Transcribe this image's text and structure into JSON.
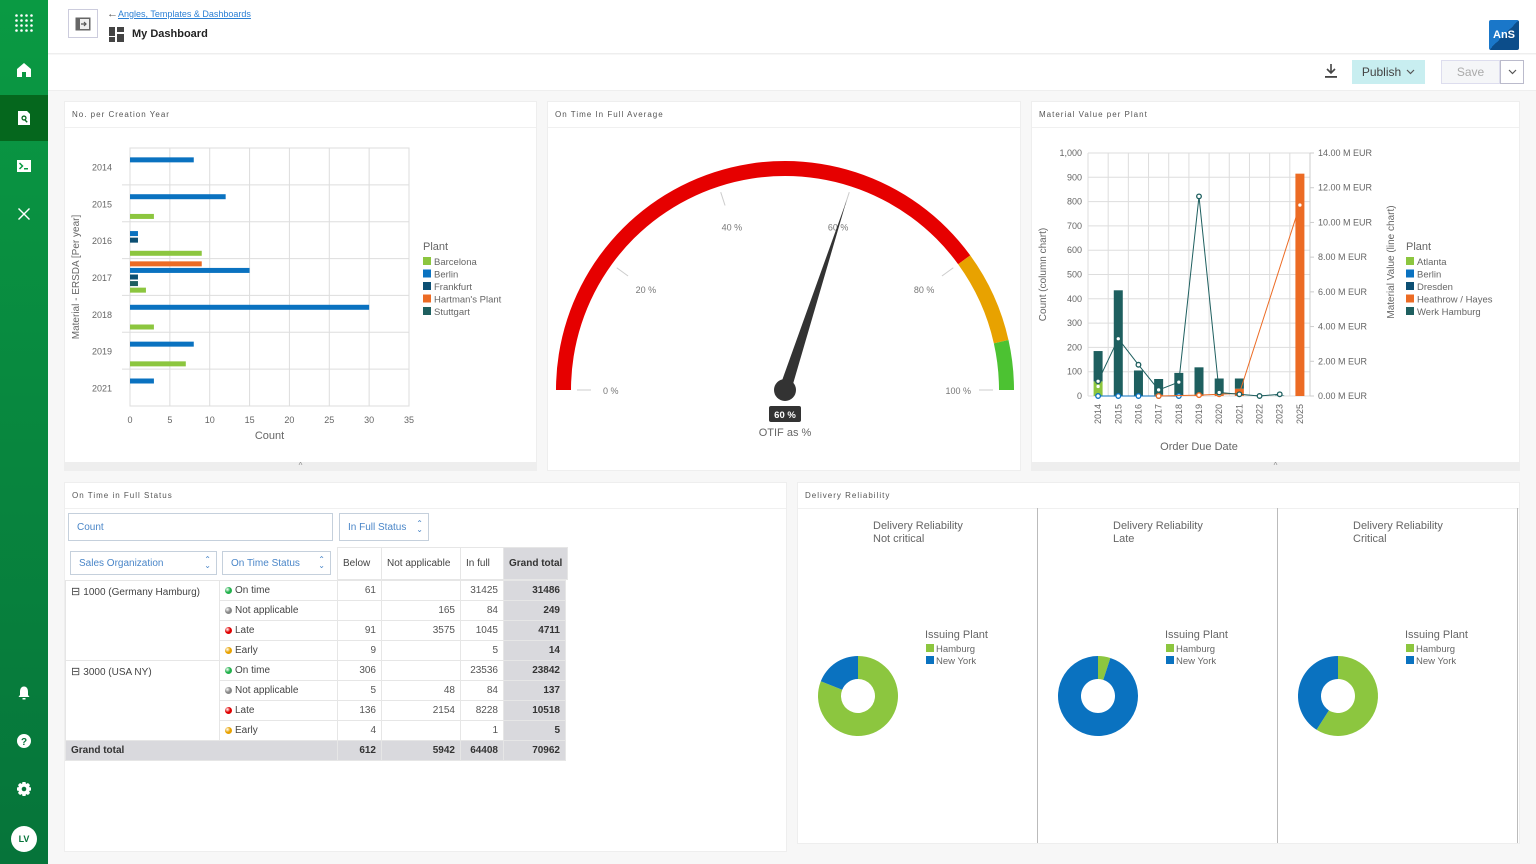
{
  "sidebar": {
    "items": [
      {
        "name": "apps-grid",
        "label": "Apps"
      },
      {
        "name": "home",
        "label": "Home"
      },
      {
        "name": "search-document",
        "label": "Search",
        "active": true
      },
      {
        "name": "terminal",
        "label": "Console"
      },
      {
        "name": "tools",
        "label": "Tools"
      }
    ],
    "bottom": [
      {
        "name": "bell",
        "label": "Notifications"
      },
      {
        "name": "help",
        "label": "Help"
      },
      {
        "name": "gear",
        "label": "Settings"
      }
    ],
    "avatar_initials": "LV"
  },
  "header": {
    "back_link": "Angles, Templates & Dashboards",
    "title": "My Dashboard",
    "logo_text": "AnS"
  },
  "toolbar": {
    "publish_label": "Publish",
    "save_label": "Save"
  },
  "panels": {
    "p1_title": "No. per Creation Year",
    "p2_title": "On Time In Full Average",
    "p3_title": "Material Value per Plant",
    "p4_title": "On Time in Full Status",
    "p5_title": "Delivery Reliability"
  },
  "chart_data": [
    {
      "type": "bar",
      "orientation": "horizontal",
      "title": "No. per Creation Year",
      "xlabel": "Count",
      "ylabel": "Material - ERSDA [Per year]",
      "xlim": [
        0,
        35
      ],
      "xticks": [
        0,
        5,
        10,
        15,
        20,
        25,
        30,
        35
      ],
      "categories": [
        "2014",
        "2015",
        "2016",
        "2017",
        "2018",
        "2019",
        "2021"
      ],
      "legend_title": "Plant",
      "legend_position": "right",
      "series": [
        {
          "name": "Barcelona",
          "color": "#8cc63f",
          "values": [
            0,
            3,
            9,
            2,
            3,
            7,
            0
          ]
        },
        {
          "name": "Berlin",
          "color": "#0a72c0",
          "values": [
            8,
            12,
            1,
            15,
            30,
            8,
            3
          ]
        },
        {
          "name": "Frankfurt",
          "color": "#0c4f73",
          "values": [
            0,
            0,
            1,
            1,
            0,
            0,
            0
          ]
        },
        {
          "name": "Hartman's Plant",
          "color": "#ec6b24",
          "values": [
            0,
            0,
            0,
            9,
            0,
            0,
            0
          ]
        },
        {
          "name": "Stuttgart",
          "color": "#1e5f5f",
          "values": [
            0,
            0,
            0,
            1,
            0,
            0,
            0
          ]
        }
      ]
    },
    {
      "type": "gauge",
      "title": "On Time In Full Average",
      "value": 60,
      "value_label": "60 %",
      "caption": "OTIF as %",
      "min": 0,
      "max": 100,
      "ticks": [
        "0 %",
        "20 %",
        "40 %",
        "60 %",
        "80 %",
        "100 %"
      ],
      "bands": [
        {
          "from": 0,
          "to": 80,
          "color": "#e60000"
        },
        {
          "from": 80,
          "to": 93,
          "color": "#e8a200"
        },
        {
          "from": 93,
          "to": 100,
          "color": "#4cc232"
        }
      ]
    },
    {
      "type": "bar+line",
      "title": "Material Value per Plant",
      "xlabel": "Order Due Date",
      "ylabel": "Count (column chart)",
      "y2label": "Material Value (line chart)",
      "ylim": [
        0,
        1000
      ],
      "yticks": [
        "0",
        "100",
        "200",
        "300",
        "400",
        "500",
        "600",
        "700",
        "800",
        "900",
        "1,000"
      ],
      "y2lim": [
        0,
        14
      ],
      "y2ticks": [
        "0.00 M EUR",
        "2.00 M EUR",
        "4.00 M EUR",
        "6.00 M EUR",
        "8.00 M EUR",
        "10.00 M EUR",
        "12.00 M EUR",
        "14.00 M EUR"
      ],
      "categories": [
        "2014",
        "2015",
        "2016",
        "2017",
        "2018",
        "2019",
        "2020",
        "2021",
        "2022",
        "2023",
        "2025"
      ],
      "legend_title": "Plant",
      "legend_position": "right",
      "bar_series": [
        {
          "name": "Atlanta",
          "color": "#8cc63f",
          "values": [
            60,
            0,
            0,
            0,
            0,
            0,
            0,
            0,
            0,
            0,
            0
          ]
        },
        {
          "name": "Heathrow / Hayes",
          "color": "#ec6b24",
          "values": [
            0,
            0,
            0,
            5,
            0,
            5,
            5,
            30,
            0,
            0,
            915
          ]
        },
        {
          "name": "Werk Hamburg",
          "color": "#1e5f5f",
          "values": [
            125,
            435,
            105,
            65,
            95,
            113,
            67,
            42,
            3,
            2,
            0
          ]
        }
      ],
      "line_series": [
        {
          "name": "Berlin",
          "color": "#0a72c0",
          "values": [
            0,
            0,
            0,
            0,
            0,
            null,
            null,
            null,
            null,
            null,
            null
          ]
        },
        {
          "name": "Atlanta",
          "color": "#8cc63f",
          "values": [
            0.55,
            null,
            null,
            null,
            null,
            null,
            null,
            null,
            null,
            null,
            null
          ]
        },
        {
          "name": "Heathrow / Hayes",
          "color": "#ec6b24",
          "values": [
            null,
            null,
            null,
            0,
            null,
            0.05,
            0.1,
            0.15,
            null,
            null,
            11.0
          ]
        },
        {
          "name": "Werk Hamburg",
          "color": "#1e5f5f",
          "values": [
            0.85,
            3.3,
            1.8,
            0.35,
            0.8,
            11.5,
            0.2,
            0.1,
            0,
            0.1,
            null
          ]
        }
      ],
      "legend": [
        {
          "name": "Atlanta",
          "color": "#8cc63f"
        },
        {
          "name": "Berlin",
          "color": "#0a72c0"
        },
        {
          "name": "Dresden",
          "color": "#0c4f73"
        },
        {
          "name": "Heathrow / Hayes",
          "color": "#ec6b24"
        },
        {
          "name": "Werk Hamburg",
          "color": "#1e5f5f"
        }
      ]
    },
    {
      "type": "table",
      "title": "On Time in Full Status",
      "value_field": "Count",
      "column_field": "In Full Status",
      "row_fields": [
        "Sales Organization",
        "On Time Status"
      ],
      "columns": [
        "Below",
        "Not applicable",
        "In full",
        "Grand total"
      ],
      "groups": [
        {
          "label": "1000 (Germany Hamburg)",
          "rows": [
            {
              "status": "On time",
              "color": "#22b14c",
              "values": [
                "61",
                "",
                "31425",
                "31486"
              ]
            },
            {
              "status": "Not applicable",
              "color": "#888888",
              "values": [
                "",
                "165",
                "84",
                "249"
              ]
            },
            {
              "status": "Late",
              "color": "#e00000",
              "values": [
                "91",
                "3575",
                "1045",
                "4711"
              ]
            },
            {
              "status": "Early",
              "color": "#e8a200",
              "values": [
                "9",
                "",
                "5",
                "14"
              ]
            }
          ]
        },
        {
          "label": "3000 (USA NY)",
          "rows": [
            {
              "status": "On time",
              "color": "#22b14c",
              "values": [
                "306",
                "",
                "23536",
                "23842"
              ]
            },
            {
              "status": "Not applicable",
              "color": "#888888",
              "values": [
                "5",
                "48",
                "84",
                "137"
              ]
            },
            {
              "status": "Late",
              "color": "#e00000",
              "values": [
                "136",
                "2154",
                "8228",
                "10518"
              ]
            },
            {
              "status": "Early",
              "color": "#e8a200",
              "values": [
                "4",
                "",
                "1",
                "5"
              ]
            }
          ]
        }
      ],
      "grand_total_label": "Grand total",
      "grand_total": [
        "612",
        "5942",
        "64408",
        "70962"
      ]
    },
    {
      "type": "pie",
      "title": "Delivery Reliability",
      "subtitle": "Not critical",
      "legend_title": "Issuing Plant",
      "slices": [
        {
          "name": "Hamburg",
          "color": "#8cc63f",
          "value": 81
        },
        {
          "name": "New York",
          "color": "#0a72c0",
          "value": 19
        }
      ]
    },
    {
      "type": "pie",
      "title": "Delivery Reliability",
      "subtitle": "Late",
      "legend_title": "Issuing Plant",
      "slices": [
        {
          "name": "Hamburg",
          "color": "#8cc63f",
          "value": 5
        },
        {
          "name": "New York",
          "color": "#0a72c0",
          "value": 95
        }
      ]
    },
    {
      "type": "pie",
      "title": "Delivery Reliability",
      "subtitle": "Critical",
      "legend_title": "Issuing Plant",
      "slices": [
        {
          "name": "Hamburg",
          "color": "#8cc63f",
          "value": 59
        },
        {
          "name": "New York",
          "color": "#0a72c0",
          "value": 41
        }
      ]
    }
  ]
}
